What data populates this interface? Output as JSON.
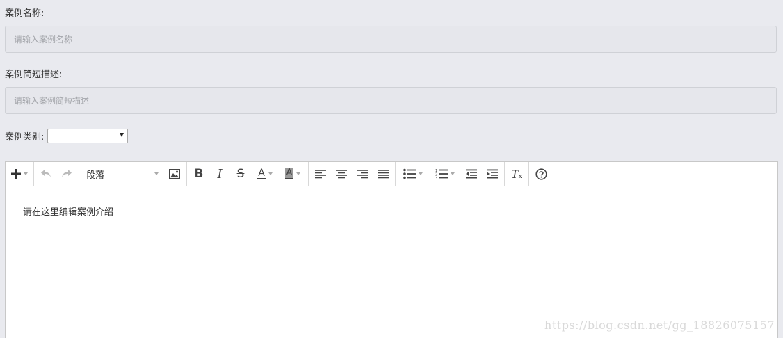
{
  "form": {
    "name_label": "案例名称:",
    "name_placeholder": "请输入案例名称",
    "name_value": "",
    "desc_label": "案例简短描述:",
    "desc_placeholder": "请输入案例简短描述",
    "desc_value": "",
    "category_label": "案例类别:",
    "category_selected": ""
  },
  "editor": {
    "toolbar": {
      "insert_icon": "plus-icon",
      "undo_icon": "undo-icon",
      "redo_icon": "redo-icon",
      "format_label": "段落",
      "image_icon": "image-icon",
      "bold_icon": "bold-icon",
      "italic_icon": "italic-icon",
      "strike_icon": "strikethrough-icon",
      "text_color_icon": "text-color-icon",
      "bg_color_icon": "background-color-icon",
      "align_icons": [
        "align-left-icon",
        "align-center-icon",
        "align-right-icon",
        "align-justify-icon"
      ],
      "list_icons": [
        "bullet-list-icon",
        "numbered-list-icon"
      ],
      "indent_icons": [
        "outdent-icon",
        "indent-icon"
      ],
      "clear_format_icon": "clear-format-icon",
      "help_icon": "help-icon"
    },
    "content_text": "请在这里编辑案例介绍"
  },
  "watermark": "https://blog.csdn.net/gg_18826075157",
  "colors": {
    "page_bg": "#e9eaef",
    "input_bg": "#e6e7ec",
    "editor_bg": "#ffffff"
  }
}
